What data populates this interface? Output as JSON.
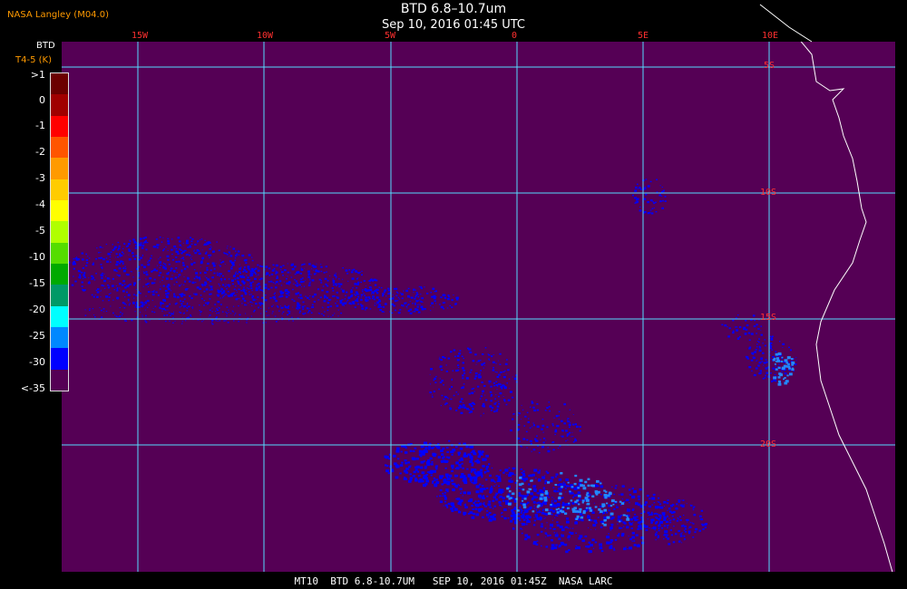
{
  "header": {
    "producer": "NASA Langley (M04.0)",
    "title": "BTD 6.8–10.7um",
    "subtitle": "Sep 10, 2016 01:45 UTC"
  },
  "colorbar": {
    "title": "BTD",
    "unit": "T4-5 (K)",
    "ticks": [
      ">1",
      "0",
      "-1",
      "-2",
      "-3",
      "-4",
      "-5",
      "-10",
      "-15",
      "-20",
      "-25",
      "-30",
      "<-35"
    ],
    "colors": [
      "#6b0000",
      "#a00000",
      "#ff0000",
      "#ff5500",
      "#ff9a00",
      "#ffcc00",
      "#ffff00",
      "#b0ff00",
      "#55dd00",
      "#00aa00",
      "#009966",
      "#00ffff",
      "#0088ff",
      "#0000ff",
      "#550055"
    ]
  },
  "grid": {
    "longitudes": [
      "15W",
      "10W",
      "5W",
      "0",
      "5E",
      "10E"
    ],
    "latitudes": [
      "5S",
      "10S",
      "15S",
      "20S"
    ],
    "line_color": "#55ddff"
  },
  "map": {
    "background_color": "#550055",
    "coastline_color": "#ffffff",
    "cloud_color": "#0000ff",
    "cloud_light_color": "#2288ff"
  },
  "footer": {
    "caption": "MT10  BTD 6.8-10.7UM   SEP 10, 2016 01:45Z  NASA LARC"
  }
}
